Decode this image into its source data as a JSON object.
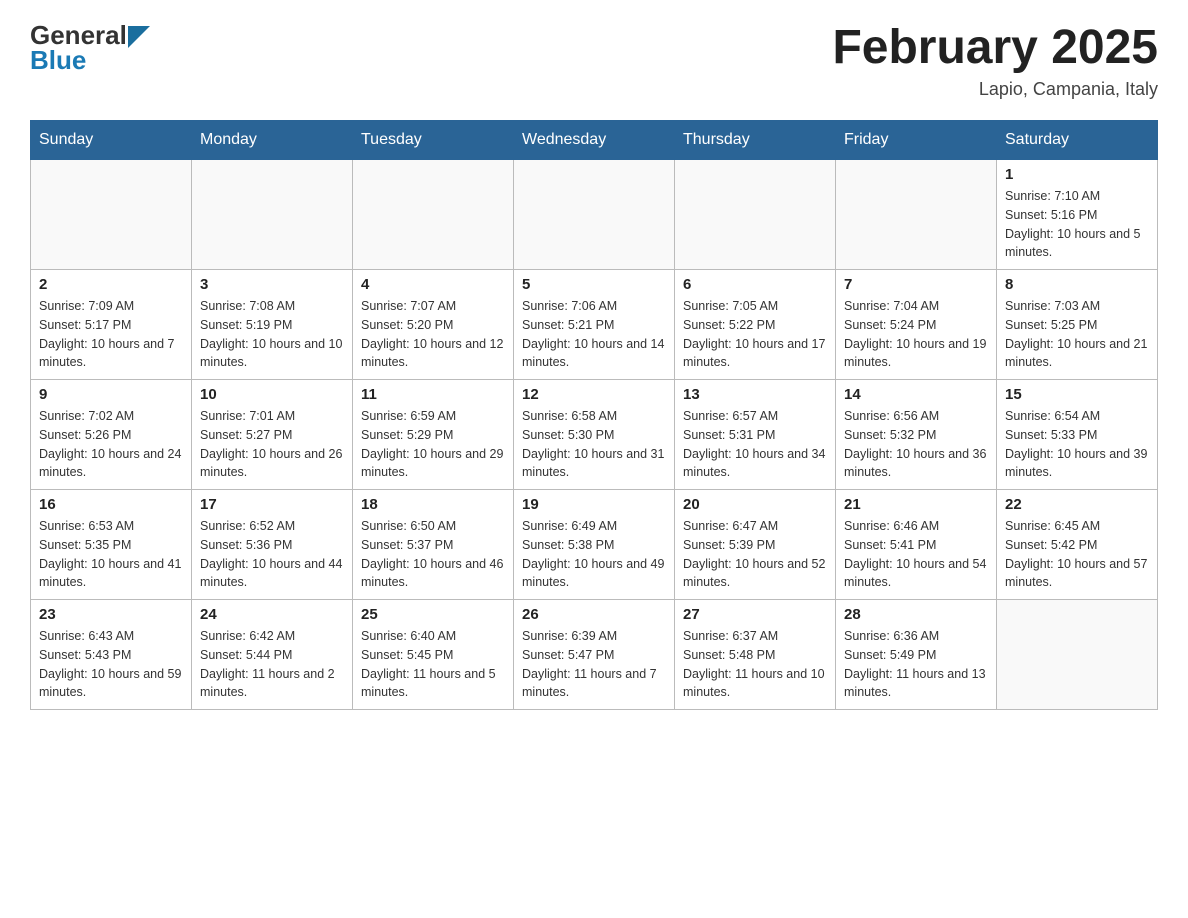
{
  "header": {
    "logo_general": "General",
    "logo_blue": "Blue",
    "month_title": "February 2025",
    "location": "Lapio, Campania, Italy"
  },
  "days_of_week": [
    "Sunday",
    "Monday",
    "Tuesday",
    "Wednesday",
    "Thursday",
    "Friday",
    "Saturday"
  ],
  "weeks": [
    [
      {
        "day": "",
        "info": ""
      },
      {
        "day": "",
        "info": ""
      },
      {
        "day": "",
        "info": ""
      },
      {
        "day": "",
        "info": ""
      },
      {
        "day": "",
        "info": ""
      },
      {
        "day": "",
        "info": ""
      },
      {
        "day": "1",
        "info": "Sunrise: 7:10 AM\nSunset: 5:16 PM\nDaylight: 10 hours and 5 minutes."
      }
    ],
    [
      {
        "day": "2",
        "info": "Sunrise: 7:09 AM\nSunset: 5:17 PM\nDaylight: 10 hours and 7 minutes."
      },
      {
        "day": "3",
        "info": "Sunrise: 7:08 AM\nSunset: 5:19 PM\nDaylight: 10 hours and 10 minutes."
      },
      {
        "day": "4",
        "info": "Sunrise: 7:07 AM\nSunset: 5:20 PM\nDaylight: 10 hours and 12 minutes."
      },
      {
        "day": "5",
        "info": "Sunrise: 7:06 AM\nSunset: 5:21 PM\nDaylight: 10 hours and 14 minutes."
      },
      {
        "day": "6",
        "info": "Sunrise: 7:05 AM\nSunset: 5:22 PM\nDaylight: 10 hours and 17 minutes."
      },
      {
        "day": "7",
        "info": "Sunrise: 7:04 AM\nSunset: 5:24 PM\nDaylight: 10 hours and 19 minutes."
      },
      {
        "day": "8",
        "info": "Sunrise: 7:03 AM\nSunset: 5:25 PM\nDaylight: 10 hours and 21 minutes."
      }
    ],
    [
      {
        "day": "9",
        "info": "Sunrise: 7:02 AM\nSunset: 5:26 PM\nDaylight: 10 hours and 24 minutes."
      },
      {
        "day": "10",
        "info": "Sunrise: 7:01 AM\nSunset: 5:27 PM\nDaylight: 10 hours and 26 minutes."
      },
      {
        "day": "11",
        "info": "Sunrise: 6:59 AM\nSunset: 5:29 PM\nDaylight: 10 hours and 29 minutes."
      },
      {
        "day": "12",
        "info": "Sunrise: 6:58 AM\nSunset: 5:30 PM\nDaylight: 10 hours and 31 minutes."
      },
      {
        "day": "13",
        "info": "Sunrise: 6:57 AM\nSunset: 5:31 PM\nDaylight: 10 hours and 34 minutes."
      },
      {
        "day": "14",
        "info": "Sunrise: 6:56 AM\nSunset: 5:32 PM\nDaylight: 10 hours and 36 minutes."
      },
      {
        "day": "15",
        "info": "Sunrise: 6:54 AM\nSunset: 5:33 PM\nDaylight: 10 hours and 39 minutes."
      }
    ],
    [
      {
        "day": "16",
        "info": "Sunrise: 6:53 AM\nSunset: 5:35 PM\nDaylight: 10 hours and 41 minutes."
      },
      {
        "day": "17",
        "info": "Sunrise: 6:52 AM\nSunset: 5:36 PM\nDaylight: 10 hours and 44 minutes."
      },
      {
        "day": "18",
        "info": "Sunrise: 6:50 AM\nSunset: 5:37 PM\nDaylight: 10 hours and 46 minutes."
      },
      {
        "day": "19",
        "info": "Sunrise: 6:49 AM\nSunset: 5:38 PM\nDaylight: 10 hours and 49 minutes."
      },
      {
        "day": "20",
        "info": "Sunrise: 6:47 AM\nSunset: 5:39 PM\nDaylight: 10 hours and 52 minutes."
      },
      {
        "day": "21",
        "info": "Sunrise: 6:46 AM\nSunset: 5:41 PM\nDaylight: 10 hours and 54 minutes."
      },
      {
        "day": "22",
        "info": "Sunrise: 6:45 AM\nSunset: 5:42 PM\nDaylight: 10 hours and 57 minutes."
      }
    ],
    [
      {
        "day": "23",
        "info": "Sunrise: 6:43 AM\nSunset: 5:43 PM\nDaylight: 10 hours and 59 minutes."
      },
      {
        "day": "24",
        "info": "Sunrise: 6:42 AM\nSunset: 5:44 PM\nDaylight: 11 hours and 2 minutes."
      },
      {
        "day": "25",
        "info": "Sunrise: 6:40 AM\nSunset: 5:45 PM\nDaylight: 11 hours and 5 minutes."
      },
      {
        "day": "26",
        "info": "Sunrise: 6:39 AM\nSunset: 5:47 PM\nDaylight: 11 hours and 7 minutes."
      },
      {
        "day": "27",
        "info": "Sunrise: 6:37 AM\nSunset: 5:48 PM\nDaylight: 11 hours and 10 minutes."
      },
      {
        "day": "28",
        "info": "Sunrise: 6:36 AM\nSunset: 5:49 PM\nDaylight: 11 hours and 13 minutes."
      },
      {
        "day": "",
        "info": ""
      }
    ]
  ]
}
